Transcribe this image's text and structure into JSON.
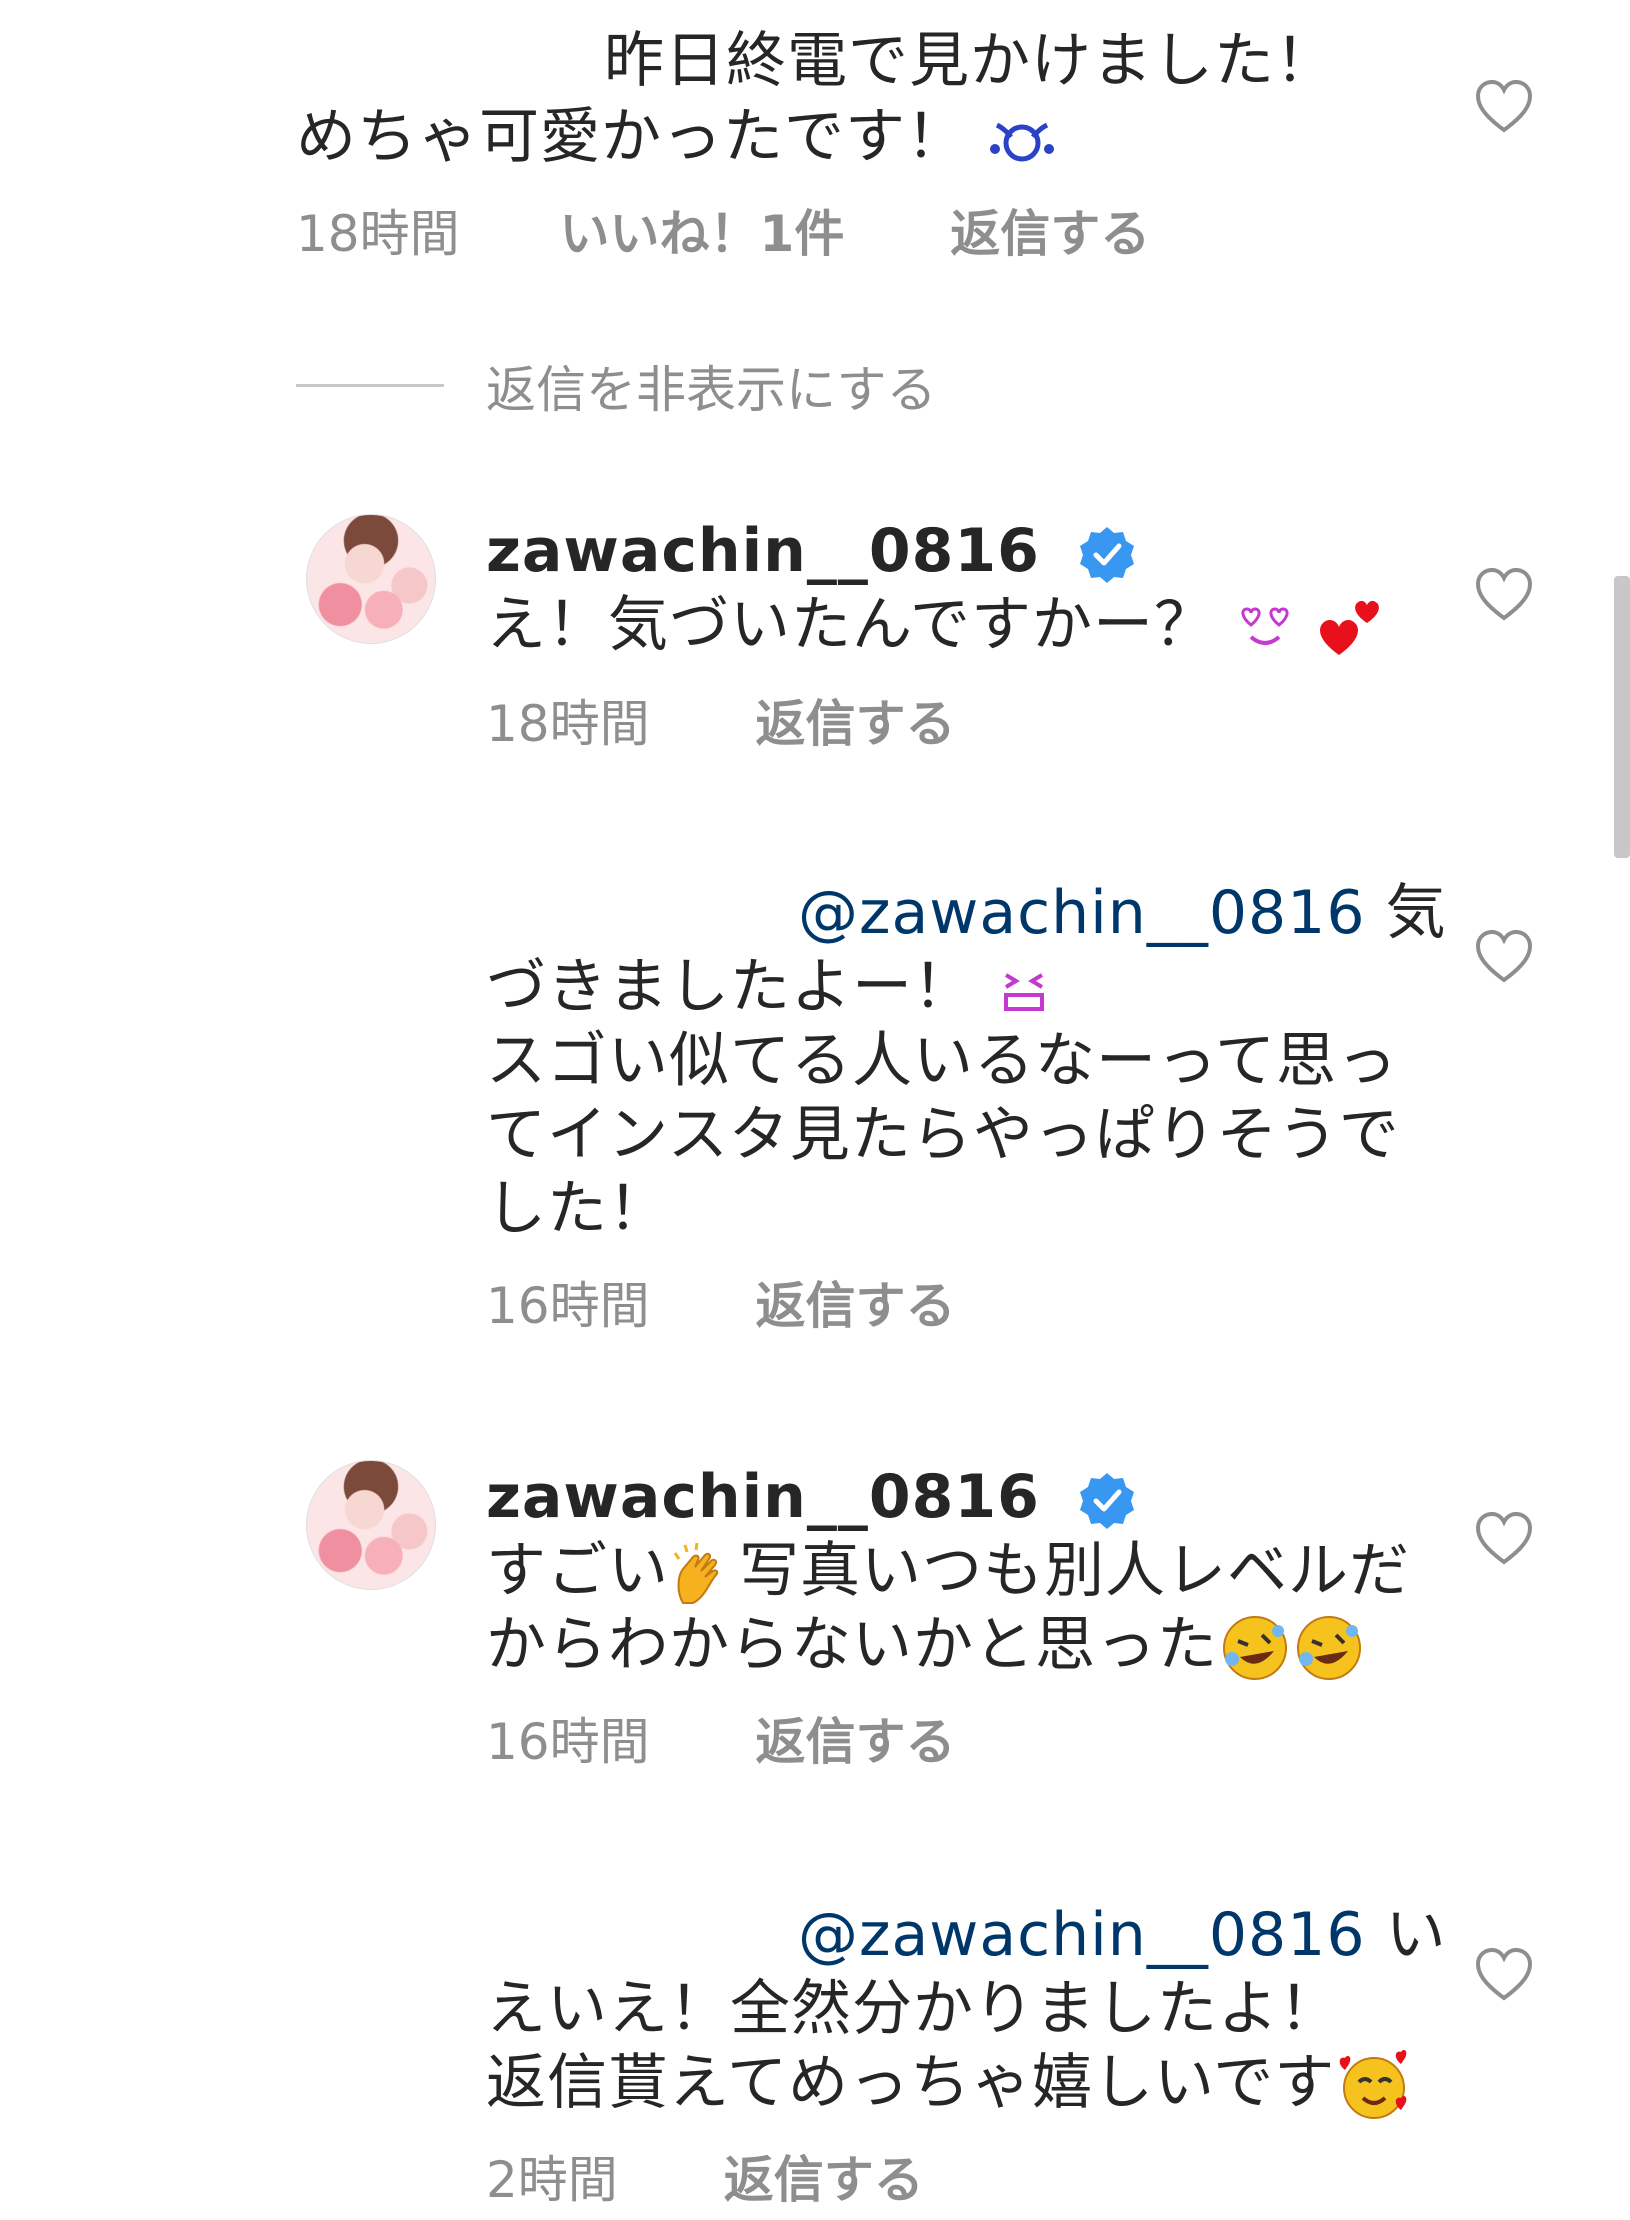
{
  "comment1": {
    "line1": "昨日終電で見かけました！",
    "line2": "めちゃ可愛かったです！",
    "time": "18時間",
    "likes": "いいね！1件",
    "reply": "返信する"
  },
  "hide_replies": "返信を非表示にする",
  "reply1": {
    "username": "zawachin__0816",
    "text": "え！気づいたんですかー？",
    "time": "18時間",
    "reply": "返信する"
  },
  "reply2": {
    "mention": "@zawachin__0816",
    "line1_rest": " 気",
    "line2": "づきましたよー！",
    "line3": "スゴい似てる人いるなーって思っ",
    "line4": "てインスタ見たらやっぱりそうで",
    "line5": "した！",
    "time": "16時間",
    "reply": "返信する"
  },
  "reply3": {
    "username": "zawachin__0816",
    "line1_a": "すごい",
    "line1_b": "写真いつも別人レベルだ",
    "line2": "からわからないかと思った",
    "time": "16時間",
    "reply": "返信する"
  },
  "reply4": {
    "mention": "@zawachin__0816",
    "line1_rest": " い",
    "line2": "えいえ！全然分かりましたよ！",
    "line3": "返信貰えてめっちゃ嬉しいです",
    "time": "2時間",
    "reply": "返信する"
  },
  "icons": {
    "heart": "heart-outline-icon",
    "verified": "verified-badge-icon",
    "accent_blue": "#3897f0",
    "mention_color": "#00376b"
  }
}
